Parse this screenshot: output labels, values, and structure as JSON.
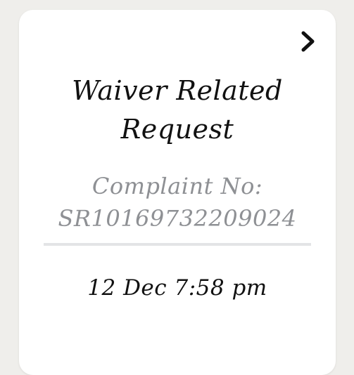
{
  "card": {
    "title_line1": "Waiver Related",
    "title_line2": "Request",
    "complaint_label": "Complaint No:",
    "complaint_number": "SR10169732209024",
    "datetime": "12 Dec 7:58 pm",
    "action_icon": "chevron-right-icon"
  },
  "colors": {
    "background": "#efeeeb",
    "card": "#ffffff",
    "title_text": "#111111",
    "secondary_text": "#8e9094",
    "divider": "#e3e4e6"
  }
}
